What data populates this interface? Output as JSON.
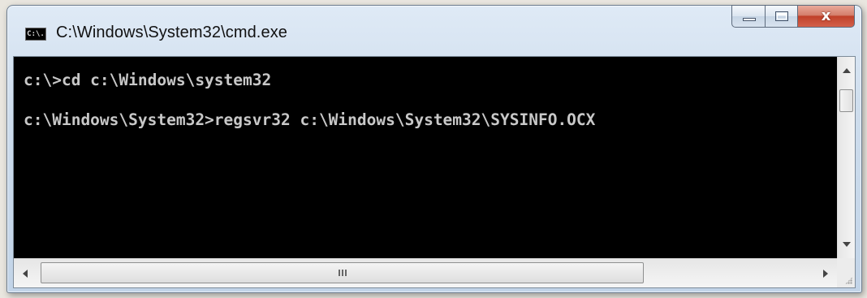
{
  "window": {
    "title": "C:\\Windows\\System32\\cmd.exe",
    "app_icon_text": "C:\\.",
    "caption_buttons": {
      "minimize": "minimize",
      "maximize": "maximize",
      "close_glyph": "x"
    }
  },
  "console": {
    "lines": [
      "c:\\>cd c:\\Windows\\system32",
      "c:\\Windows\\System32>regsvr32 c:\\Windows\\System32\\SYSINFO.OCX"
    ]
  },
  "scrollbars": {
    "vertical": {
      "position_fraction": 0.0
    },
    "horizontal": {
      "position_fraction": 0.0,
      "thumb_grip": "III"
    }
  },
  "colors": {
    "console_background": "#000000",
    "console_text": "#c8c8c8",
    "close_button": "#c0412a"
  }
}
